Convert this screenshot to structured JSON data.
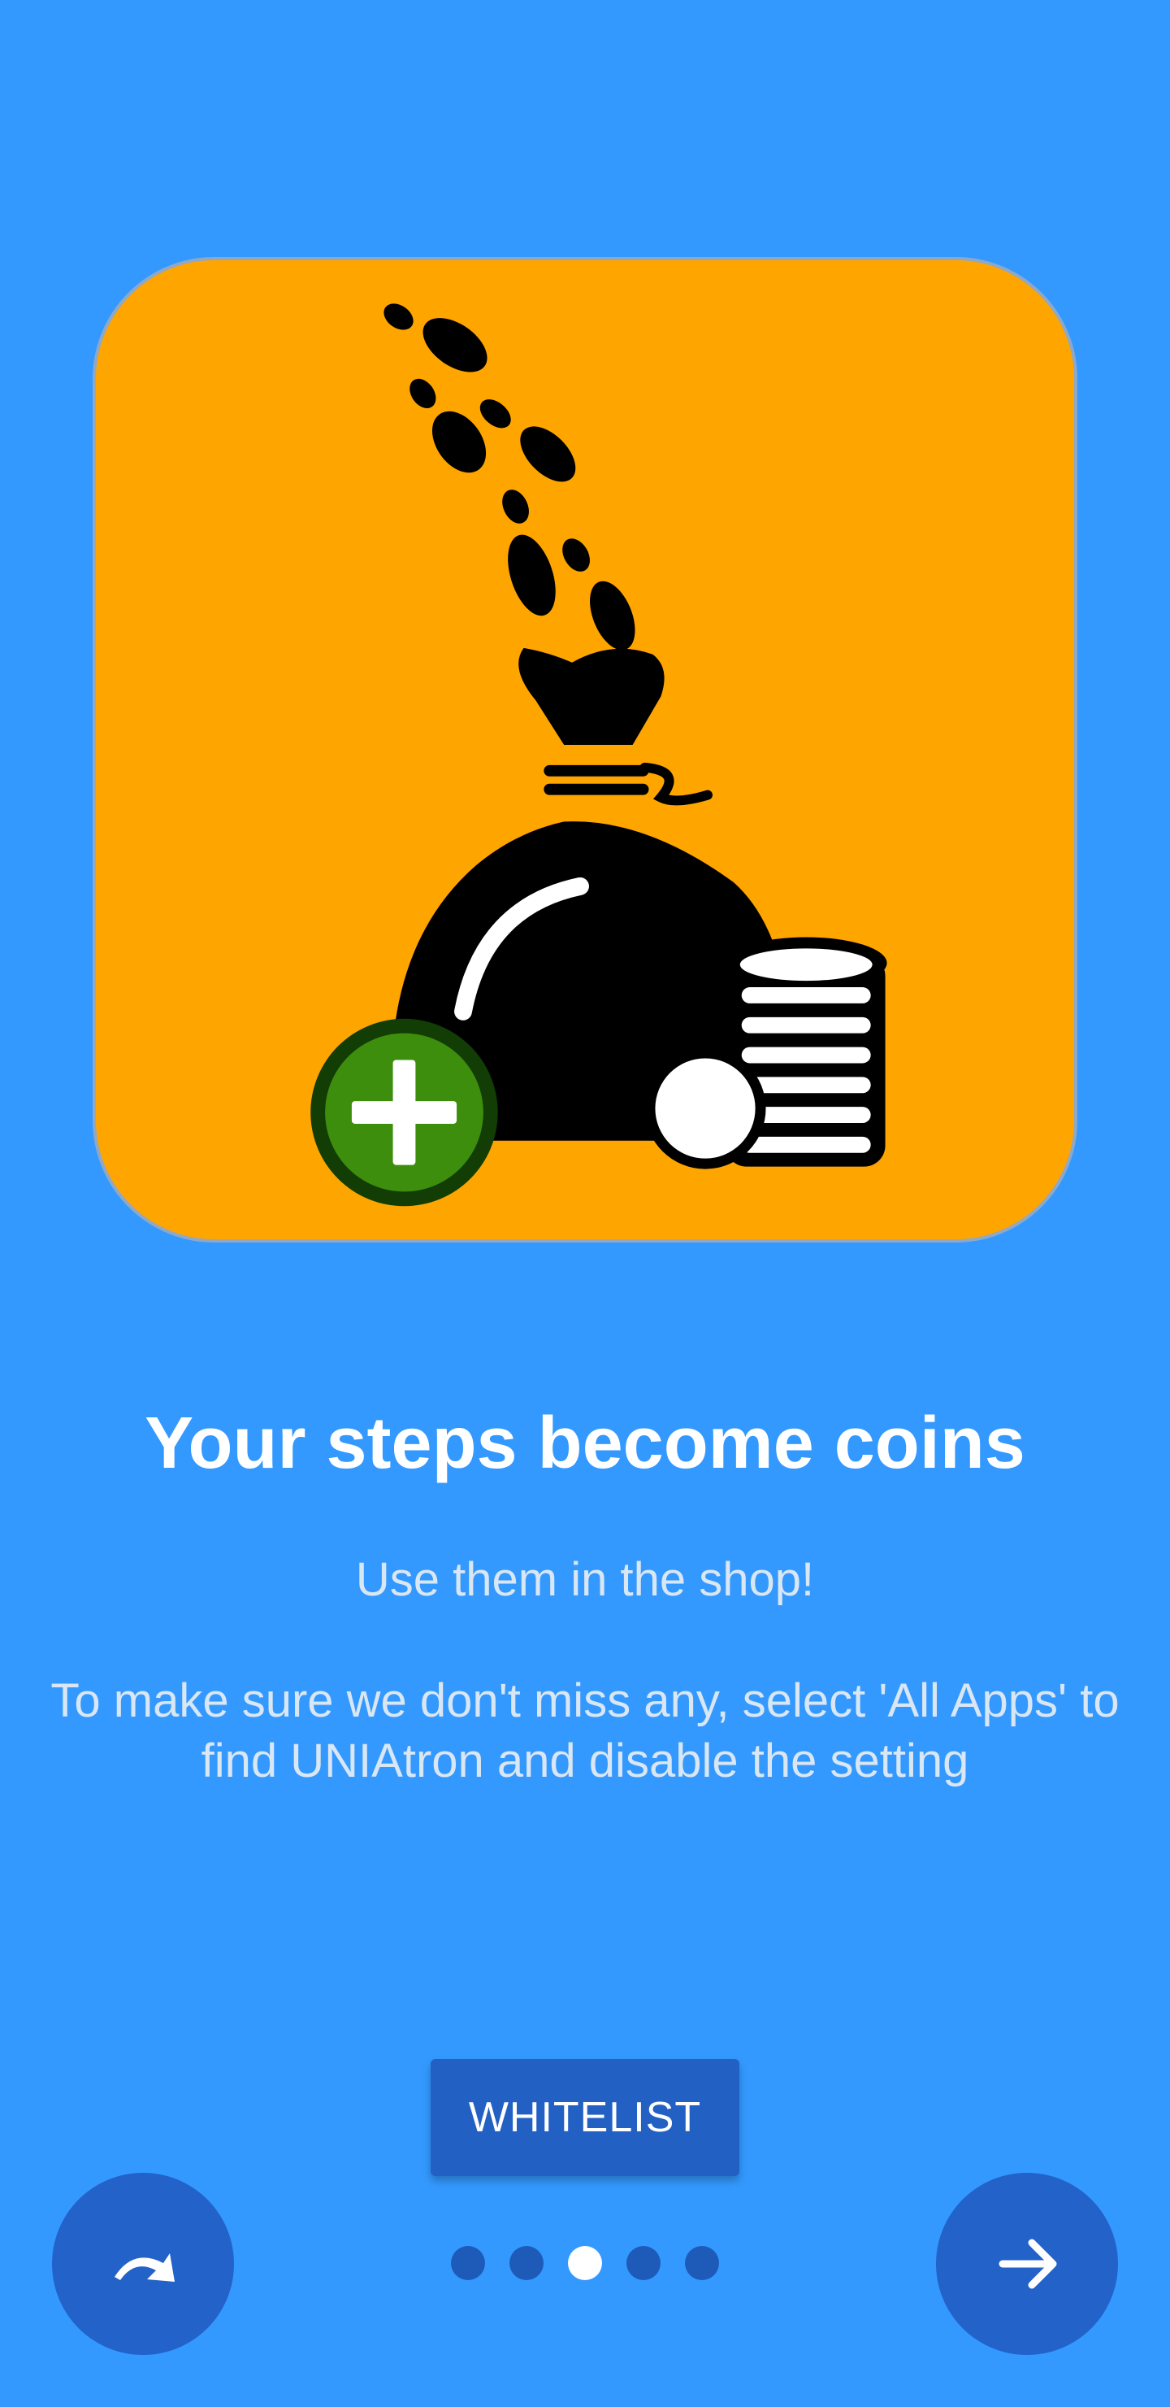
{
  "onboarding": {
    "title": "Your steps become coins",
    "subtitle": "Use them in the shop!",
    "description": "To make sure we don't miss any, select 'All Apps' to find UNIAtron and disable the setting",
    "whitelist_label": "WHITELIST",
    "illustration_icon": "money-bag-steps-coins-plus-icon",
    "skip_icon": "redo-arrow-icon",
    "next_icon": "arrow-right-icon",
    "page_count": 5,
    "current_page": 3
  },
  "colors": {
    "background": "#3399FF",
    "card": "#FFA500",
    "button": "#2360C4",
    "plus_badge": "#3E8E0E",
    "dot_active": "#FFFFFF",
    "dot_inactive": "#1E5BB8"
  }
}
